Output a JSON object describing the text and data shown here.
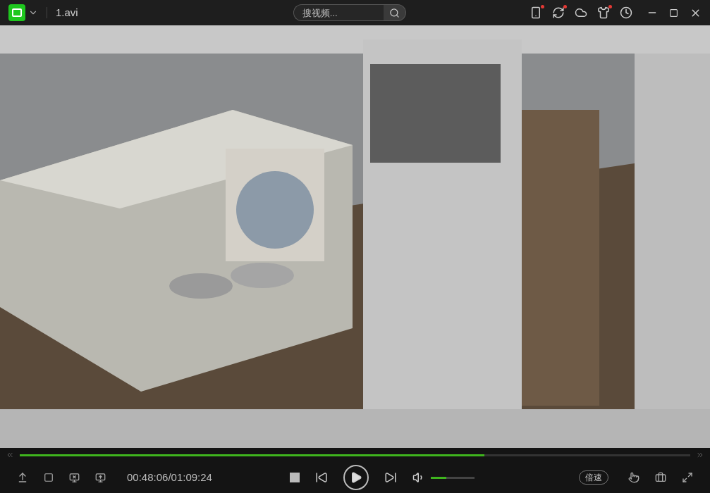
{
  "title_bar": {
    "title": "1.avi",
    "search": {
      "placeholder": "搜视频..."
    },
    "tools": [
      {
        "kind": "phone",
        "dot": true
      },
      {
        "kind": "share",
        "dot": true
      },
      {
        "kind": "cloud",
        "dot": false
      },
      {
        "kind": "shirt",
        "dot": true
      },
      {
        "kind": "history",
        "dot": false
      }
    ]
  },
  "player": {
    "progress": {
      "level": 0.693
    },
    "time": "00:48:06/01:09:24",
    "volume": {
      "level": 0.35
    },
    "speed_button": "倍速"
  }
}
